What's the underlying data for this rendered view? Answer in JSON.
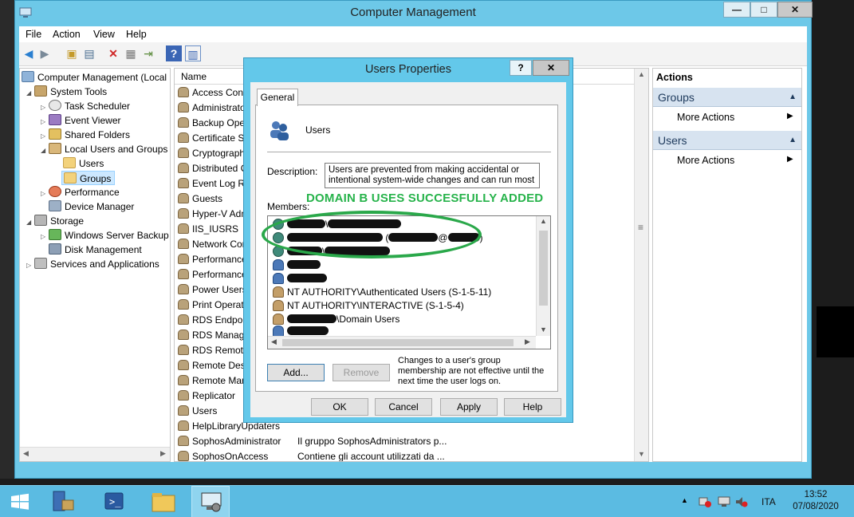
{
  "window": {
    "title": "Computer Management",
    "minimize": "—",
    "maximize": "□",
    "close": "✕"
  },
  "menu": [
    "File",
    "Action",
    "View",
    "Help"
  ],
  "tree": {
    "root": "Computer Management (Local",
    "system_tools": "System Tools",
    "task_scheduler": "Task Scheduler",
    "event_viewer": "Event Viewer",
    "shared_folders": "Shared Folders",
    "local_users_groups": "Local Users and Groups",
    "users": "Users",
    "groups": "Groups",
    "performance": "Performance",
    "device_manager": "Device Manager",
    "storage": "Storage",
    "wsb": "Windows Server Backup",
    "disk_mgmt": "Disk Management",
    "services": "Services and Applications"
  },
  "list": {
    "col_name": "Name",
    "rows": [
      "Access Contr",
      "Administrato",
      "Backup Oper",
      "Certificate Se",
      "Cryptograph",
      "Distributed C",
      "Event Log Re",
      "Guests",
      "Hyper-V Adm",
      "IIS_IUSRS",
      "Network Cor",
      "Performance",
      "Performance",
      "Power Users",
      "Print Operato",
      "RDS Endpoin",
      "RDS Manage",
      "RDS Remote",
      "Remote Desk",
      "Remote Man",
      "Replicator",
      "Users",
      "HelpLibraryUpdaters",
      "SophosAdministrator",
      "SophosOnAccess"
    ],
    "desc_sophos_admin": "Il gruppo SophosAdministrators p...",
    "desc_sophos_access": "Contiene gli account utilizzati da ..."
  },
  "actions": {
    "title": "Actions",
    "groups": "Groups",
    "users": "Users",
    "more1": "More Actions",
    "more2": "More Actions"
  },
  "dialog": {
    "title": "Users Properties",
    "help": "?",
    "close": "✕",
    "tab": "General",
    "group_name": "Users",
    "desc_label": "Description:",
    "desc_value": "Users are prevented from making accidental or intentional system-wide changes and can run most",
    "members_label": "Members:",
    "members": [
      {
        "text": "\\",
        "hidden": true
      },
      {
        "text": "(",
        "hidden": true
      },
      {
        "text": "\\",
        "hidden": true
      },
      {
        "text": "",
        "hidden": true
      },
      {
        "text": "",
        "hidden": true
      },
      {
        "text": "NT AUTHORITY\\Authenticated Users (S-1-5-11)"
      },
      {
        "text": "NT AUTHORITY\\INTERACTIVE (S-1-5-4)"
      },
      {
        "text": "\\Domain Users"
      },
      {
        "text": "",
        "hidden": true
      }
    ],
    "member_email_at": "@",
    "note": "Changes to a user's group membership are not effective until the next time the user logs on.",
    "add": "Add...",
    "remove": "Remove",
    "ok": "OK",
    "cancel": "Cancel",
    "apply": "Apply",
    "help_btn": "Help"
  },
  "annotation": "DOMAIN B USES SUCCESFULLY ADDED",
  "taskbar": {
    "lang": "ITA",
    "time": "13:52",
    "date": "07/08/2020"
  },
  "colors": {
    "accent": "#63c8ea",
    "annotation": "#27b34b"
  }
}
